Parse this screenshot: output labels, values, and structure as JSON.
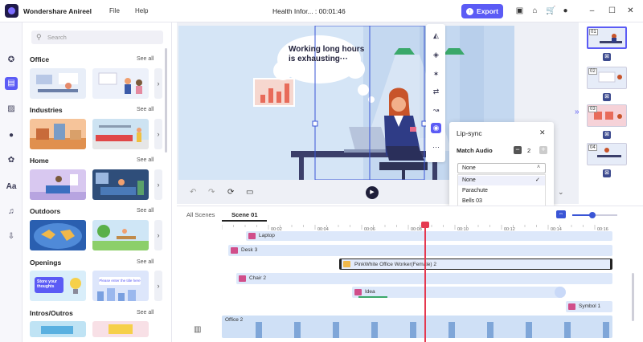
{
  "app": {
    "name": "Wondershare Anireel",
    "menu": [
      "File",
      "Help"
    ],
    "doc_title": "Health Infor... : 00:01:46",
    "export_label": "Export"
  },
  "library": {
    "search_placeholder": "Search",
    "see_all": "See all",
    "sections": [
      "Office",
      "Industries",
      "Home",
      "Outdoors",
      "Openings",
      "Intros/Outros"
    ],
    "openings_thumb_texts": [
      "Store your thoughts",
      "Please enter the title here"
    ]
  },
  "preview": {
    "speech_bubble": "Working long hours is exhausting···"
  },
  "lipsync": {
    "title": "Lip-sync",
    "match_audio_label": "Match Audio",
    "count": "2",
    "selected": "None",
    "options": [
      "None",
      "Parachute",
      "Bells 03"
    ]
  },
  "scenes": [
    "01",
    "02",
    "03",
    "04"
  ],
  "timeline": {
    "tabs": [
      "All Scenes",
      "Scene 01"
    ],
    "ticks": [
      "00:02",
      "00:04",
      "00:06",
      "00:08",
      "00:10",
      "00:12",
      "00:14",
      "00:16"
    ],
    "tracks": [
      "Laptop",
      "Desk 3",
      "PinkWhite Office Worker(Female) 2",
      "Chair 2",
      "Idea",
      "Symbol 1",
      "Office 2"
    ]
  }
}
